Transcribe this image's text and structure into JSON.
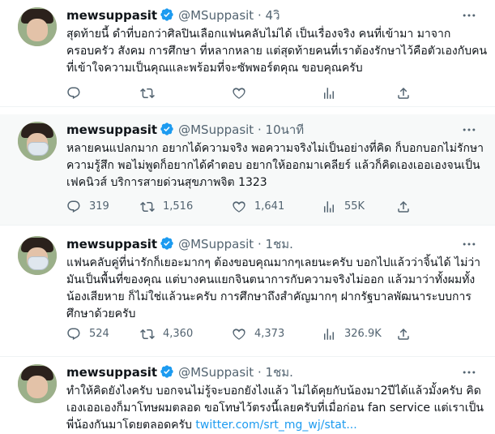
{
  "tweets": [
    {
      "name": "mewsuppasit",
      "handle": "@MSuppasit",
      "dot": "·",
      "time": "4วิ",
      "text": "สุดท้ายนี้ ดำที่บอกว่าศิลปินเลือกแฟนคลับไม่ได้ เป็นเรื่องจริง คนที่เข้ามา มาจากครอบครัว สังคม การศึกษา ที่หลากหลาย แต่สุดท้ายคนที่เราต้องรักษาไว้คือตัวเองกับคนที่เข้าใจความเป็นคุณและพร้อมที่จะซัพพอร์ตคุณ ขอบคุณครับ",
      "link": "",
      "replies": "",
      "retweets": "",
      "likes": "",
      "views": ""
    },
    {
      "name": "mewsuppasit",
      "handle": "@MSuppasit",
      "dot": "·",
      "time": "10นาที",
      "text": "หลายคนแปลกมาก อยากได้ความจริง พอความจริงไม่เป็นอย่างที่คิด ก็บอกบอกไม่รักษาความรู้สึก พอไม่พูดก็อยากได้คำตอบ อยากให้ออกมาเคลียร์ แล้วก็คิดเองเออเองจนเป็นเฟคนิวส์ บริการสายด่วนสุขภาพจิต 1323",
      "link": "",
      "replies": "319",
      "retweets": "1,516",
      "likes": "1,641",
      "views": "55K"
    },
    {
      "name": "mewsuppasit",
      "handle": "@MSuppasit",
      "dot": "·",
      "time": "1ชม.",
      "text": "แฟนคลับคู่ที่น่ารักก็เยอะมากๆ ต้องขอบคุณมากๆเลยนะครับ บอกไปแล้วว่าจิ้นได้ ไม่ว่า มันเป็นพื้นที่ของคุณ แต่บางคนแยกจินตนาการกับความจริงไม่ออก แล้วมาว่าทั้งผมทั้งน้องเสียหาย ก็ไม่ใช่แล้วนะครับ การศึกษาถึงสำคัญมากๆ ฝากรัฐบาลพัฒนาระบบการศึกษาด้วยครับ",
      "link": "",
      "replies": "524",
      "retweets": "4,360",
      "likes": "4,373",
      "views": "326.9K"
    },
    {
      "name": "mewsuppasit",
      "handle": "@MSuppasit",
      "dot": "·",
      "time": "1ชม.",
      "text": "ทำให้คิดยังไงครับ บอกจนไม่รู้จะบอกยังไงแล้ว ไม่ได้คุยกับน้องมา2ปีได้แล้วมั้งครับ คิดเองเออเองก็มาโทษผมตลอด ขอโทษไว้ตรงนี้เลยครับที่เมื่อก่อน fan service แต่เราเป็นพี่น้องกันมาโดยตลอดครับ ",
      "link": "twitter.com/srt_mg_wj/stat...",
      "replies": "",
      "retweets": "",
      "likes": "",
      "views": ""
    }
  ],
  "colors": {
    "verified": "#1d9bf0",
    "secondary": "#536471",
    "link": "#1d9bf0"
  },
  "icons": [
    "verified-badge-icon",
    "more-icon",
    "reply-icon",
    "retweet-icon",
    "like-icon",
    "views-icon",
    "share-icon"
  ]
}
